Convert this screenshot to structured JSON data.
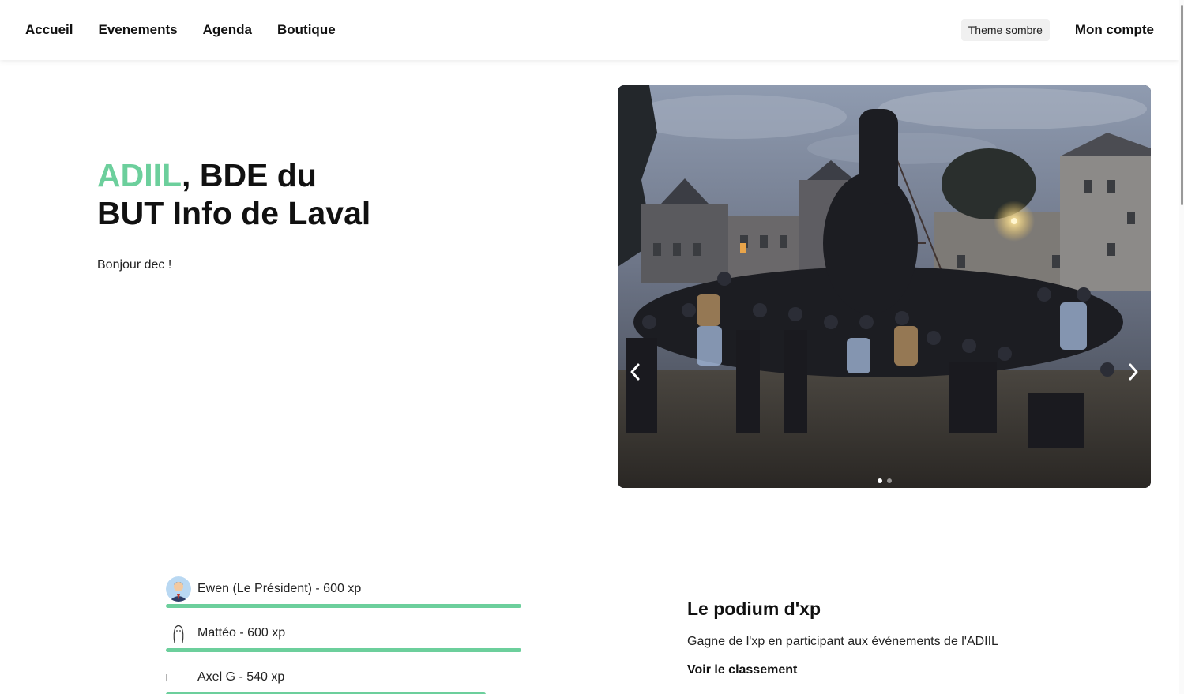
{
  "navbar": {
    "links": [
      "Accueil",
      "Evenements",
      "Agenda",
      "Boutique"
    ],
    "theme_button": "Theme sombre",
    "account": "Mon compte"
  },
  "hero": {
    "title_accent": "ADIIL",
    "title_rest_line1": ", BDE du",
    "title_line2": "BUT Info de Laval",
    "greeting": "Bonjour dec !"
  },
  "carousel": {
    "slide_count": 2,
    "active_slide": 1,
    "prev_icon": "chevron-left-icon",
    "next_icon": "chevron-right-icon"
  },
  "leaderboard": {
    "max_xp": 600,
    "bar_color": "#6ccf9c",
    "entries": [
      {
        "label": "Ewen (Le Président) - 600 xp",
        "xp": 600,
        "avatar": "president-avatar"
      },
      {
        "label": "Mattéo - 600 xp",
        "xp": 600,
        "avatar": "sketch-avatar"
      },
      {
        "label": "Axel G - 540 xp",
        "xp": 540,
        "avatar": "blank-avatar"
      }
    ]
  },
  "podium": {
    "title": "Le podium d'xp",
    "description": "Gagne de l'xp en participant aux événements de l'ADIIL",
    "link": "Voir le classement"
  },
  "colors": {
    "accent": "#6ccf9c"
  }
}
